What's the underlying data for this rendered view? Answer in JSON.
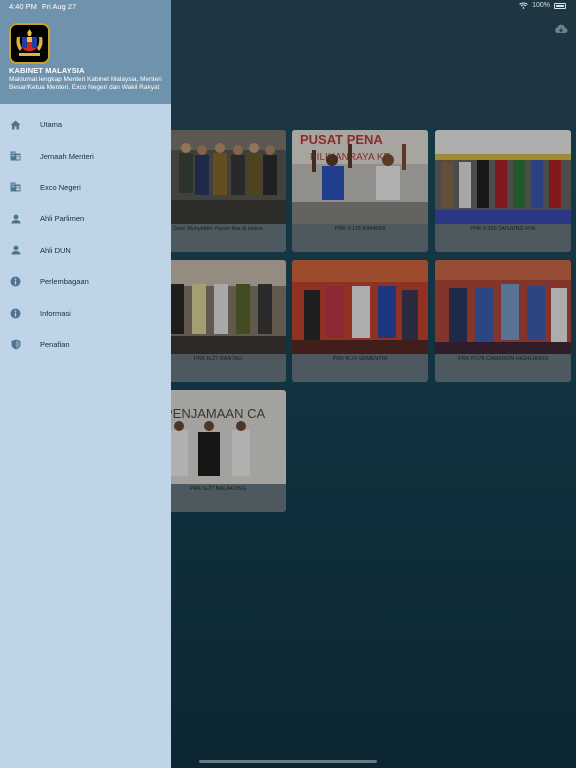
{
  "status_bar": {
    "time": "4:40 PM",
    "date": "Fri Aug 27",
    "battery": "100%"
  },
  "drawer": {
    "title": "KABINET MALAYSIA",
    "subtitle": "Maklumat lengkap Menteri Kabinet Malaysia, Menteri Besar/Ketua Menteri, Exco Negeri dan Wakil Rakyat",
    "items": [
      {
        "label": "Utama",
        "icon": "home-icon"
      },
      {
        "label": "Jemaah Menteri",
        "icon": "building-icon"
      },
      {
        "label": "Exco Negeri",
        "icon": "building-icon"
      },
      {
        "label": "Ahli Parlimen",
        "icon": "person-icon"
      },
      {
        "label": "Ahli DUN",
        "icon": "person-icon"
      },
      {
        "label": "Perlembagaan",
        "icon": "info-icon"
      },
      {
        "label": "Informasi",
        "icon": "info-icon"
      },
      {
        "label": "Penafian",
        "icon": "shield-icon"
      }
    ]
  },
  "cards": [
    {
      "caption": "Dato' Muhyiddin Yassin tiba di Istana"
    },
    {
      "caption": "PRK P.176 KIMANIS",
      "banner": "PUSAT PENA",
      "banner2": "PILIHANRAYA KE"
    },
    {
      "caption": "PRK P.165 TANJUNG PIAI"
    },
    {
      "caption": "PRK N.27 RANTAU"
    },
    {
      "caption": "PRK N.24 SEMENYIH"
    },
    {
      "caption": "PRK P.078 CAMERON HIGHLANDS"
    },
    {
      "caption": "PRK N.27 BALAKONG",
      "banner": "PENJAMAAN CA"
    }
  ],
  "colors": {
    "drawer_bg": "#bfd4e6",
    "drawer_header": "#6f93ad",
    "icon": "#4d7590",
    "main_bg": "#1b4a5d"
  }
}
